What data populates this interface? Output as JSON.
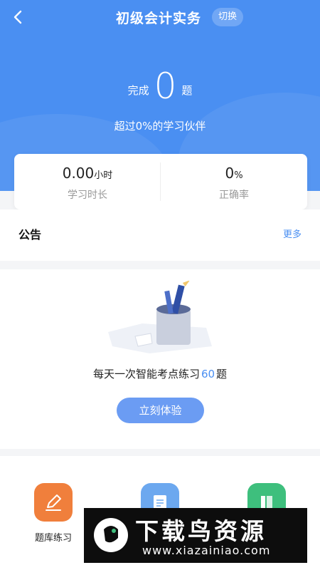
{
  "header": {
    "title": "初级会计实务",
    "switch_label": "切换"
  },
  "summary": {
    "done_prefix": "完成",
    "done_count": "0",
    "done_suffix": "题",
    "beat_text": "超过0%的学习伙伴"
  },
  "stats": [
    {
      "value": "0.00",
      "unit": "小时",
      "label": "学习时长"
    },
    {
      "value": "0",
      "unit": "%",
      "label": "正确率"
    }
  ],
  "notice": {
    "title": "公告",
    "more_label": "更多"
  },
  "practice": {
    "text_prefix": "每天一次智能考点练习",
    "count": "60",
    "text_suffix": "题",
    "button_label": "立刻体验"
  },
  "tiles": [
    {
      "label": "题库练习",
      "icon": "pencil-icon",
      "color": "#f07f3c"
    },
    {
      "label": "",
      "icon": "text-document-icon",
      "color": "#6ca8ef"
    },
    {
      "label": "",
      "icon": "book-icon",
      "color": "#3ebf7d"
    }
  ],
  "watermark": {
    "title": "下载鸟资源",
    "url": "www.xiazainiao.com"
  },
  "colors": {
    "primary": "#4a8ff2",
    "button": "#6b9cf3"
  }
}
